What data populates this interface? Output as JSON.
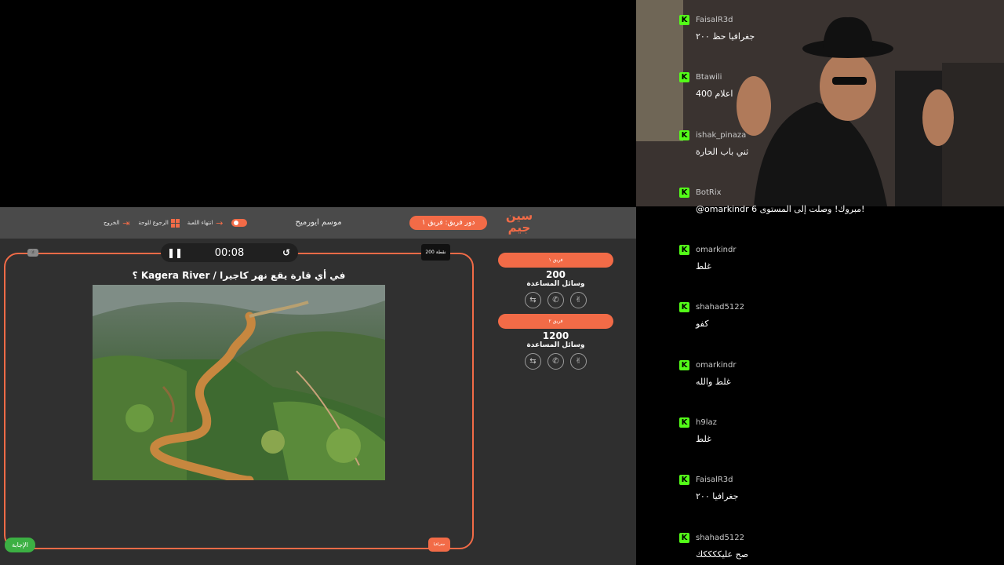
{
  "game": {
    "logo": "سين جيم",
    "turn_label": "دور فريق:  فريق ١",
    "season": "موسم ايورميح",
    "toolbar": {
      "end_game": "انتهاء اللعبة",
      "back_board": "الرجوع للوحة",
      "exit": "الخروج"
    },
    "mini_tag": "ⓓ",
    "timer": "00:08",
    "points_tag": "200 نقطة",
    "question": "في أي قارة يقع نهر كاجيرا / Kagera River ؟",
    "category_tag": "جغرافيا",
    "answer_button": "الإجابة",
    "teams": [
      {
        "name": "فريق ١",
        "score": "200",
        "aids_label": "وسائل المساعدة"
      },
      {
        "name": "فريق ٢",
        "score": "1200",
        "aids_label": "وسائل المساعدة"
      }
    ],
    "colors": {
      "accent": "#f26b47",
      "answer": "#3cb043",
      "bg": "#2f2f2f"
    }
  },
  "chat": {
    "badge": "K",
    "messages": [
      {
        "user": "FaisalR3d",
        "text": "جغرافيا حظ ٢٠٠"
      },
      {
        "user": "Btawili",
        "text": "اعلام 400"
      },
      {
        "user": "ishak_pinaza",
        "text": "ثني باب الحارة"
      },
      {
        "user": "BotRix",
        "text": "!مبروك! وصلت إلى المستوى 6 omarkindr@"
      },
      {
        "user": "omarkindr",
        "text": "غلط"
      },
      {
        "user": "shahad5122",
        "text": "كفو"
      },
      {
        "user": "omarkindr",
        "text": "غلط والله"
      },
      {
        "user": "h9laz",
        "text": "غلط"
      },
      {
        "user": "FaisalR3d",
        "text": "جغرافيا ٢٠٠"
      },
      {
        "user": "shahad5122",
        "text": "صح عليككككك"
      }
    ]
  }
}
